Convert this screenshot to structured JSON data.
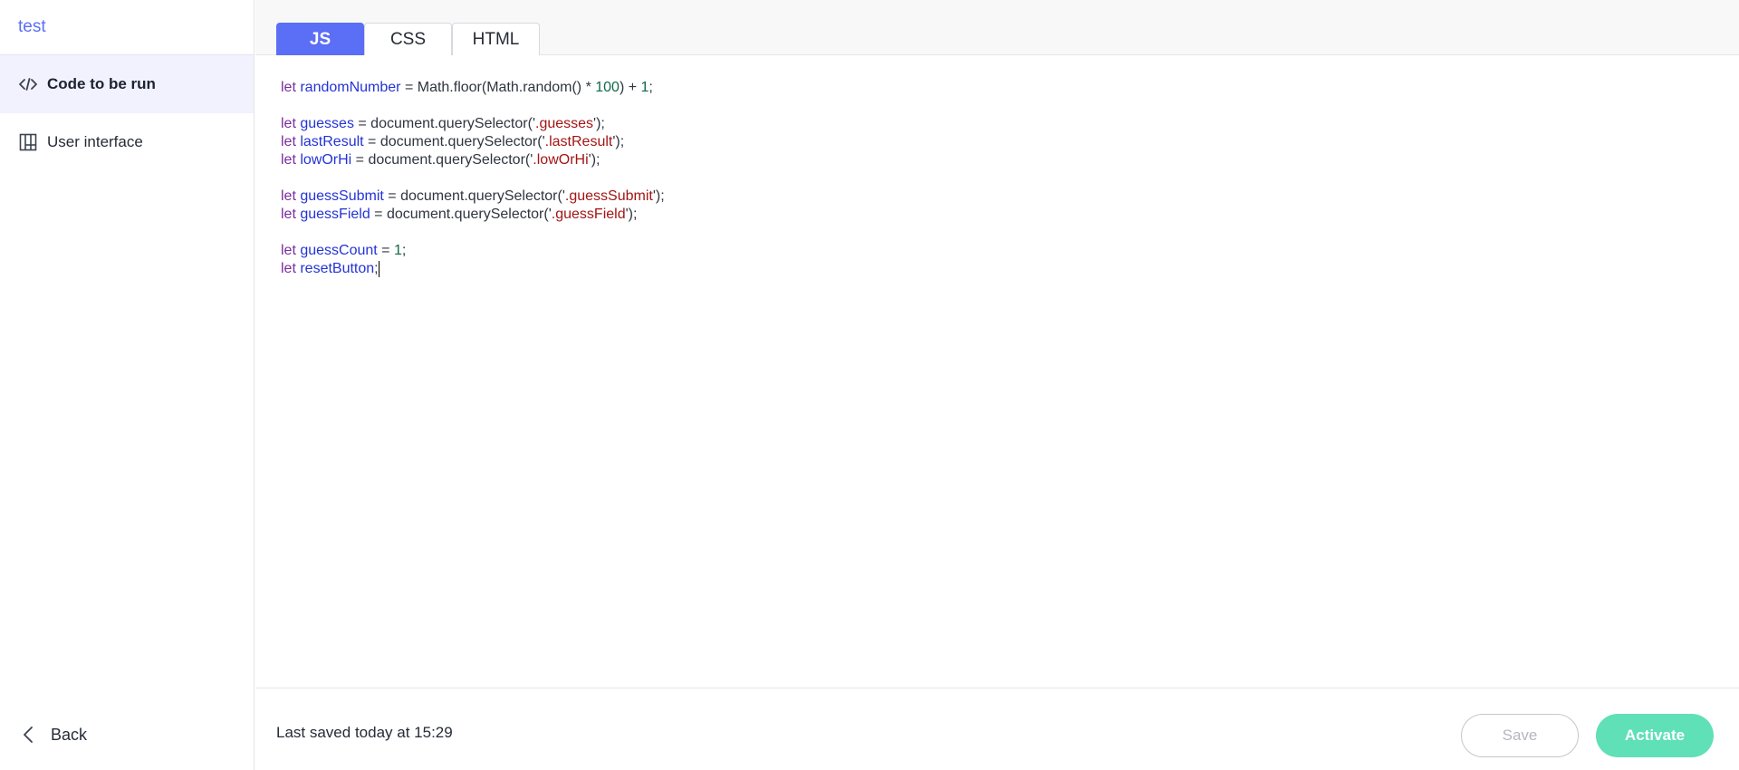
{
  "sidebar": {
    "project_title": "test",
    "items": [
      {
        "label": "Code to be run",
        "icon": "code-icon",
        "active": true
      },
      {
        "label": "User interface",
        "icon": "layout-icon",
        "active": false
      }
    ],
    "back_label": "Back"
  },
  "tabs": [
    {
      "label": "JS",
      "active": true
    },
    {
      "label": "CSS",
      "active": false
    },
    {
      "label": "HTML",
      "active": false
    }
  ],
  "code_lines": [
    [
      [
        "kw",
        "let "
      ],
      [
        "var",
        "randomNumber"
      ],
      [
        "p",
        " = Math.floor(Math.random() * "
      ],
      [
        "num",
        "100"
      ],
      [
        "p",
        ") + "
      ],
      [
        "num",
        "1"
      ],
      [
        "p",
        ";"
      ]
    ],
    [],
    [
      [
        "kw",
        "let "
      ],
      [
        "var",
        "guesses"
      ],
      [
        "p",
        " = document.querySelector("
      ],
      [
        "p",
        "'"
      ],
      [
        "str",
        ".guesses"
      ],
      [
        "p",
        "');"
      ]
    ],
    [
      [
        "kw",
        "let "
      ],
      [
        "var",
        "lastResult"
      ],
      [
        "p",
        " = document.querySelector("
      ],
      [
        "p",
        "'"
      ],
      [
        "str",
        ".lastResult"
      ],
      [
        "p",
        "');"
      ]
    ],
    [
      [
        "kw",
        "let "
      ],
      [
        "var",
        "lowOrHi"
      ],
      [
        "p",
        " = document.querySelector("
      ],
      [
        "p",
        "'"
      ],
      [
        "str",
        ".lowOrHi"
      ],
      [
        "p",
        "');"
      ]
    ],
    [],
    [
      [
        "kw",
        "let "
      ],
      [
        "var",
        "guessSubmit"
      ],
      [
        "p",
        " = document.querySelector("
      ],
      [
        "p",
        "'"
      ],
      [
        "str",
        ".guessSubmit"
      ],
      [
        "p",
        "');"
      ]
    ],
    [
      [
        "kw",
        "let "
      ],
      [
        "var",
        "guessField"
      ],
      [
        "p",
        " = document.querySelector("
      ],
      [
        "p",
        "'"
      ],
      [
        "str",
        ".guessField"
      ],
      [
        "p",
        "');"
      ]
    ],
    [],
    [
      [
        "kw",
        "let "
      ],
      [
        "var",
        "guessCount"
      ],
      [
        "p",
        " = "
      ],
      [
        "num",
        "1"
      ],
      [
        "p",
        ";"
      ]
    ],
    [
      [
        "kw",
        "let "
      ],
      [
        "var",
        "resetButton"
      ],
      [
        "p",
        ";"
      ],
      [
        "cursor",
        ""
      ]
    ]
  ],
  "footer": {
    "saved_status": "Last saved today at 15:29",
    "save_label": "Save",
    "activate_label": "Activate"
  },
  "colors": {
    "accent": "#5b6ef6",
    "activate": "#5fe0b7"
  }
}
